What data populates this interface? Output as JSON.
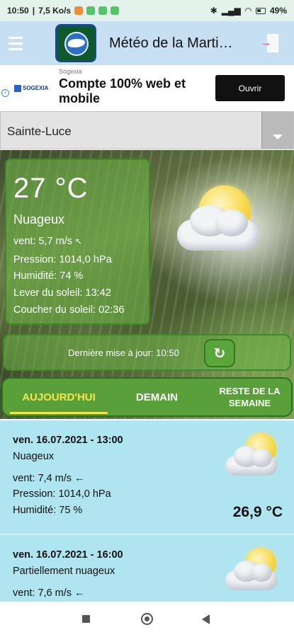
{
  "status_bar": {
    "time": "10:50",
    "speed": "7,5 Ko/s",
    "battery_percent": "49"
  },
  "app_bar": {
    "title": "Météo de la Marti…"
  },
  "ad": {
    "brand": "Sogexia",
    "logo_text": "SOGEXIA",
    "headline": "Compte 100% web et mobile",
    "cta": "Ouvrir"
  },
  "location_select": {
    "selected": "Sainte-Luce"
  },
  "current": {
    "temperature": "27 °C",
    "condition": "Nuageux",
    "wind": "vent: 5,7 m/s",
    "pressure": "Pression: 1014,0 hPa",
    "humidity": "Humidité: 74 %",
    "sunrise": "Lever du soleil: 13:42",
    "sunset": "Coucher du soleil: 02:36"
  },
  "update": {
    "label": "Dernière mise à jour: 10:50"
  },
  "tabs": {
    "today": "AUJOURD'HUI",
    "tomorrow": "DEMAIN",
    "rest_line1": "RESTE DE LA",
    "rest_line2": "SEMAINE"
  },
  "forecast": [
    {
      "datetime": "ven. 16.07.2021 - 13:00",
      "condition": "Nuageux",
      "wind": "vent: 7,4 m/s",
      "pressure": "Pression: 1014,0 hPa",
      "humidity": "Humidité: 75 %",
      "temperature": "26,9 °C"
    },
    {
      "datetime": "ven. 16.07.2021 - 16:00",
      "condition": "Partiellement nuageux",
      "wind": "vent: 7,6 m/s"
    }
  ],
  "icons": {
    "menu": "hamburger-icon",
    "exit": "exit-icon",
    "refresh": "refresh-icon",
    "dropdown": "chevron-down-icon",
    "weather": "cloud-sun-icon"
  },
  "colors": {
    "app_bar": "#c6dff3",
    "card_green": "#6cb046",
    "tab_active": "#f3e64a",
    "forecast_bg": "#aee5f0"
  }
}
